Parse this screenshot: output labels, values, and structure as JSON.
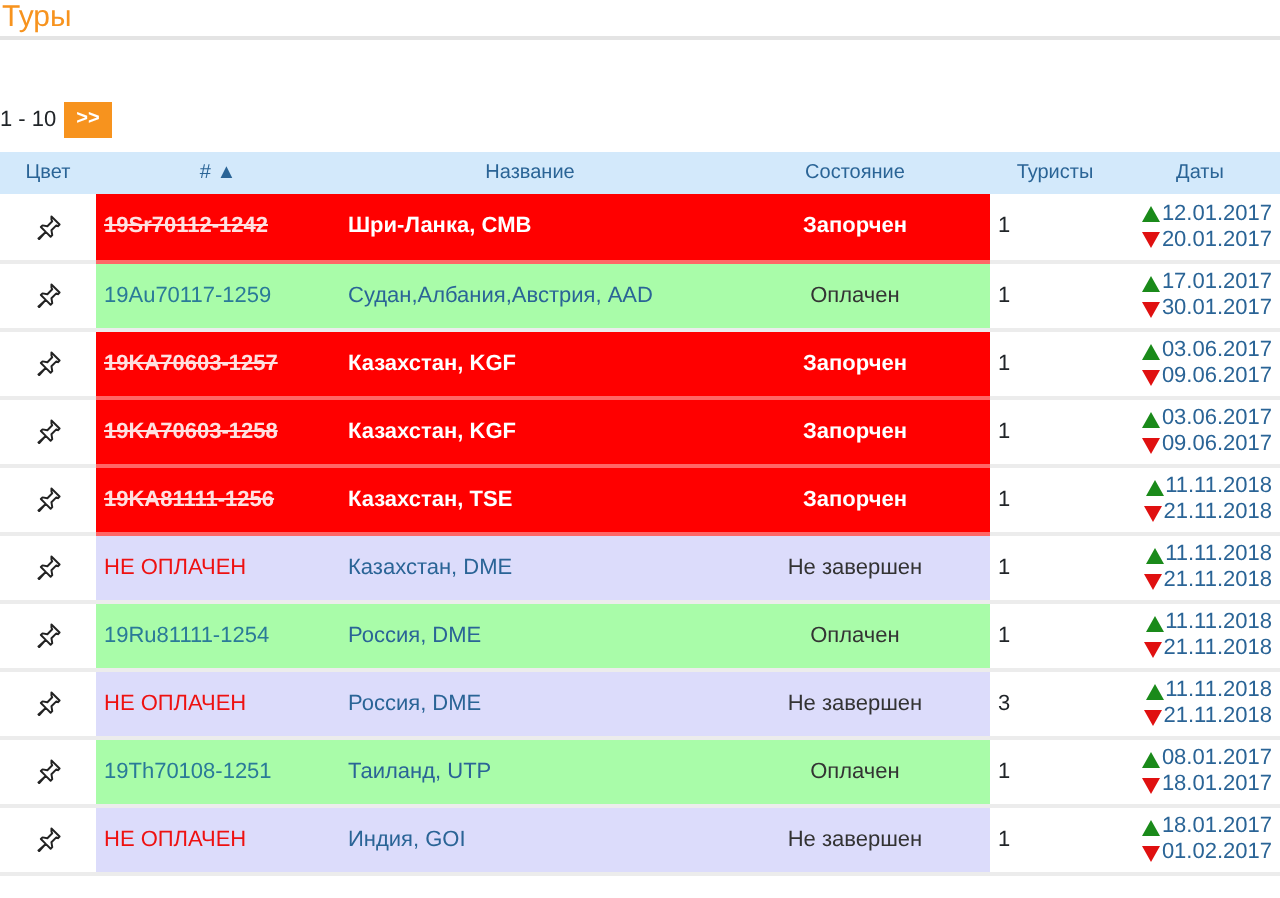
{
  "title": "Туры",
  "pager": {
    "range": "1 - 10",
    "next": ">>"
  },
  "columns": [
    {
      "label": "Цвет"
    },
    {
      "label": "#",
      "sort": "▲"
    },
    {
      "label": "Название"
    },
    {
      "label": "Состояние"
    },
    {
      "label": "Туристы"
    },
    {
      "label": "Даты"
    }
  ],
  "rows": [
    {
      "kind": "spoiled",
      "id": "19Sr70112-1242",
      "name": "Шри-Ланка, CMB",
      "state": "Запорчен",
      "tourists": "1",
      "start": "12.01.2017",
      "end": "20.01.2017"
    },
    {
      "kind": "paid",
      "id": "19Au70117-1259",
      "name": "Судан,Албания,Австрия, AAD",
      "state": "Оплачен",
      "tourists": "1",
      "start": "17.01.2017",
      "end": "30.01.2017"
    },
    {
      "kind": "spoiled",
      "id": "19KA70603-1257",
      "name": "Казахстан, KGF",
      "state": "Запорчен",
      "tourists": "1",
      "start": "03.06.2017",
      "end": "09.06.2017"
    },
    {
      "kind": "spoiled",
      "id": "19KA70603-1258",
      "name": "Казахстан, KGF",
      "state": "Запорчен",
      "tourists": "1",
      "start": "03.06.2017",
      "end": "09.06.2017"
    },
    {
      "kind": "spoiled",
      "id": "19KA81111-1256",
      "name": "Казахстан, TSE",
      "state": "Запорчен",
      "tourists": "1",
      "start": "11.11.2018",
      "end": "21.11.2018"
    },
    {
      "kind": "unpaid",
      "id": "НЕ ОПЛАЧЕН",
      "name": "Казахстан, DME",
      "state": "Не завершен",
      "tourists": "1",
      "start": "11.11.2018",
      "end": "21.11.2018"
    },
    {
      "kind": "paid",
      "id": "19Ru81111-1254",
      "name": "Россия, DME",
      "state": "Оплачен",
      "tourists": "1",
      "start": "11.11.2018",
      "end": "21.11.2018"
    },
    {
      "kind": "unpaid",
      "id": "НЕ ОПЛАЧЕН",
      "name": "Россия, DME",
      "state": "Не завершен",
      "tourists": "3",
      "start": "11.11.2018",
      "end": "21.11.2018"
    },
    {
      "kind": "paid",
      "id": "19Th70108-1251",
      "name": "Таиланд, UTP",
      "state": "Оплачен",
      "tourists": "1",
      "start": "08.01.2017",
      "end": "18.01.2017"
    },
    {
      "kind": "unpaid",
      "id": "НЕ ОПЛАЧЕН",
      "name": "Индия, GOI",
      "state": "Не завершен",
      "tourists": "1",
      "start": "18.01.2017",
      "end": "01.02.2017"
    }
  ]
}
